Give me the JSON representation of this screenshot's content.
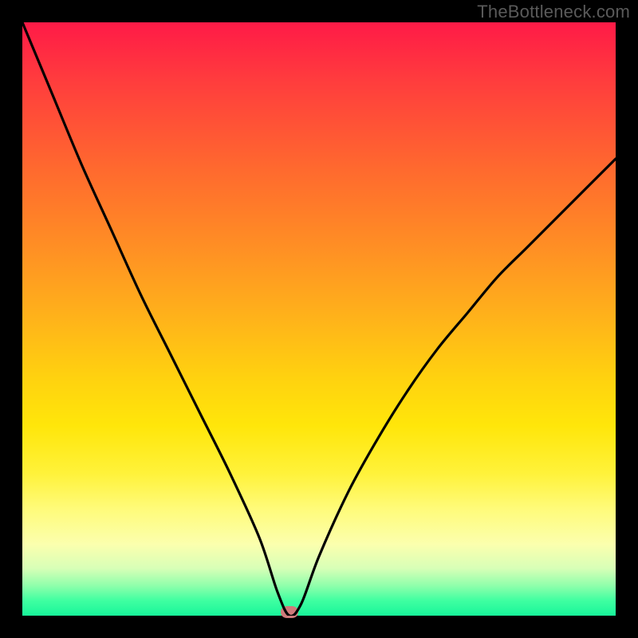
{
  "watermark": "TheBottleneck.com",
  "chart_data": {
    "type": "line",
    "title": "",
    "xlabel": "",
    "ylabel": "",
    "xlim": [
      0,
      100
    ],
    "ylim": [
      0,
      100
    ],
    "series": [
      {
        "name": "bottleneck-curve",
        "x": [
          0,
          5,
          10,
          15,
          20,
          25,
          30,
          35,
          40,
          43,
          45,
          47,
          50,
          55,
          60,
          65,
          70,
          75,
          80,
          85,
          90,
          95,
          100
        ],
        "values": [
          100,
          88,
          76,
          65,
          54,
          44,
          34,
          24,
          13,
          4,
          0,
          2,
          10,
          21,
          30,
          38,
          45,
          51,
          57,
          62,
          67,
          72,
          77
        ]
      }
    ],
    "marker": {
      "x": 45,
      "y": 0,
      "color": "#cf7a7a"
    },
    "background_gradient": [
      "#ff1a47",
      "#ffe60a",
      "#18f59a"
    ]
  },
  "colors": {
    "curve": "#000000",
    "frame": "#000000"
  }
}
